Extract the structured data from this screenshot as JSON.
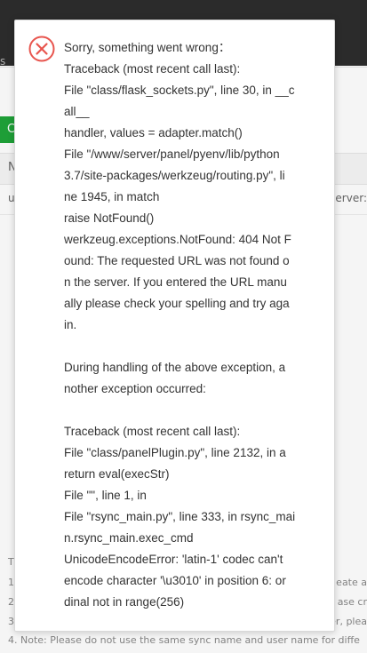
{
  "background": {
    "tab_fragment": "s",
    "green_button_fragment": "C",
    "table_header_fragment": "N",
    "row_left_fragment": "u",
    "row_right_fragment": "server:",
    "tips_heading_fragment": "T",
    "tips": [
      {
        "left": "1",
        "right": "eate a"
      },
      {
        "left": "2",
        "right": "ase cr"
      },
      {
        "left": "3",
        "right": "er, plea"
      },
      {
        "left": "4. Note: Please do not use the same sync name and user name for diffe",
        "right": ""
      }
    ]
  },
  "dialog": {
    "icon": "error-circle-x-icon",
    "icon_color": "#e8554e",
    "lines": [
      "Sorry, something went wrong：",
      "Traceback (most recent call last):",
      "File \"class/flask_sockets.py\", line 30, in __c",
      "all__",
      "handler, values = adapter.match()",
      "File \"/www/server/panel/pyenv/lib/python",
      "3.7/site-packages/werkzeug/routing.py\", li",
      "ne 1945, in match",
      "raise NotFound()",
      "werkzeug.exceptions.NotFound: 404 Not F",
      "ound: The requested URL was not found o",
      "n the server. If you entered the URL manu",
      "ally please check your spelling and try aga",
      "in.",
      "",
      "During handling of the above exception, a",
      "nother exception occurred:",
      "",
      "Traceback (most recent call last):",
      "File \"class/panelPlugin.py\", line 2132, in a",
      "return eval(execStr)",
      "File \"\", line 1, in",
      "File \"rsync_main.py\", line 333, in rsync_mai",
      "n.rsync_main.exec_cmd",
      "UnicodeEncodeError: 'latin-1' codec can't",
      "encode character '\\u3010' in position 6: or",
      "dinal not in range(256)"
    ]
  }
}
